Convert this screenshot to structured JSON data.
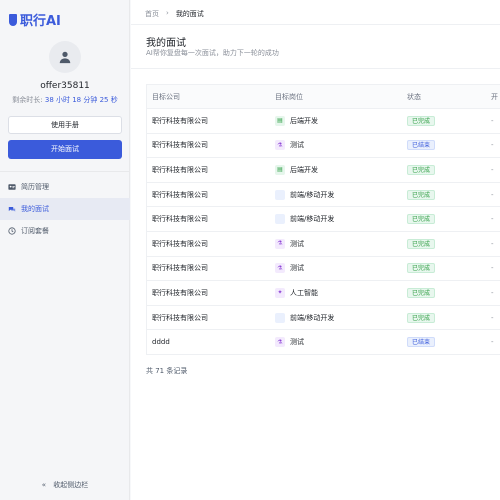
{
  "brand": {
    "name": "职行AI"
  },
  "user": {
    "name": "offer35811",
    "remaining_label": "剩余时长:",
    "remaining_value": "38 小时 18 分钟 25 秒"
  },
  "sidebar": {
    "manual_button": "使用手册",
    "start_button": "开始面试",
    "items": [
      {
        "label": "简历管理",
        "icon": "id-card-icon"
      },
      {
        "label": "我的面试",
        "icon": "chat-icon"
      },
      {
        "label": "订阅套餐",
        "icon": "clock-icon"
      }
    ],
    "collapse_label": "收起侧边栏"
  },
  "breadcrumb": {
    "home": "首页",
    "current": "我的面试"
  },
  "page": {
    "title": "我的面试",
    "subtitle": "AI帮你复盘每一次面试，助力下一轮的成功"
  },
  "table": {
    "columns": [
      "目标公司",
      "目标岗位",
      "状态",
      "开"
    ],
    "rows": [
      {
        "company": "职行科技有限公司",
        "position": "后端开发",
        "type": "backend",
        "status": "已完成",
        "status_type": "done",
        "extra": "-"
      },
      {
        "company": "职行科技有限公司",
        "position": "测试",
        "type": "test",
        "status": "已结束",
        "status_type": "ended",
        "extra": "-"
      },
      {
        "company": "职行科技有限公司",
        "position": "后端开发",
        "type": "backend",
        "status": "已完成",
        "status_type": "done",
        "extra": "-"
      },
      {
        "company": "职行科技有限公司",
        "position": "前端/移动开发",
        "type": "frontend",
        "status": "已完成",
        "status_type": "done",
        "extra": "-"
      },
      {
        "company": "职行科技有限公司",
        "position": "前端/移动开发",
        "type": "frontend",
        "status": "已完成",
        "status_type": "done",
        "extra": "-"
      },
      {
        "company": "职行科技有限公司",
        "position": "测试",
        "type": "test",
        "status": "已完成",
        "status_type": "done",
        "extra": "-"
      },
      {
        "company": "职行科技有限公司",
        "position": "测试",
        "type": "test",
        "status": "已完成",
        "status_type": "done",
        "extra": "-"
      },
      {
        "company": "职行科技有限公司",
        "position": "人工智能",
        "type": "ai",
        "status": "已完成",
        "status_type": "done",
        "extra": "-"
      },
      {
        "company": "职行科技有限公司",
        "position": "前端/移动开发",
        "type": "frontend",
        "status": "已完成",
        "status_type": "done",
        "extra": "-"
      },
      {
        "company": "dddd",
        "position": "测试",
        "type": "test",
        "status": "已结束",
        "status_type": "ended",
        "extra": "-"
      }
    ]
  },
  "total": "共 71 条记录",
  "colors": {
    "accent": "#3b5bdb",
    "success": "#2f9e44"
  }
}
